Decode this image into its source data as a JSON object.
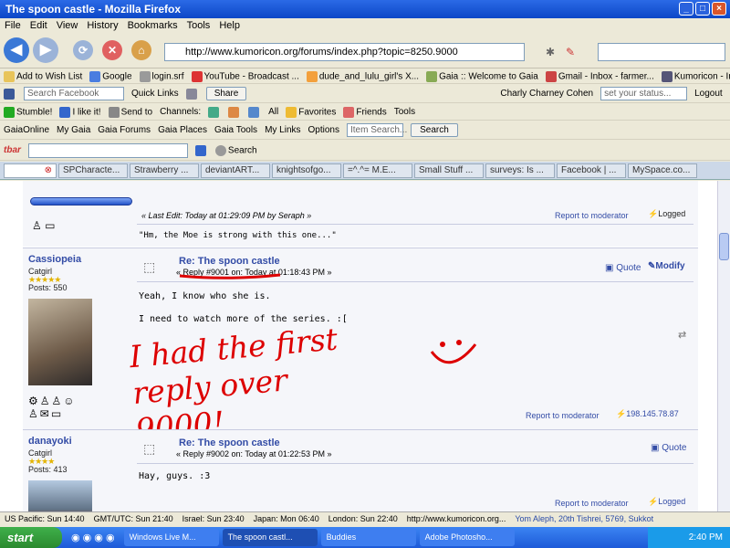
{
  "window": {
    "title": "The spoon castle - Mozilla Firefox"
  },
  "menu": [
    "File",
    "Edit",
    "View",
    "History",
    "Bookmarks",
    "Tools",
    "Help"
  ],
  "nav": {
    "url": "http://www.kumoricon.org/forums/index.php?topic=8250.9000"
  },
  "bookmarks": [
    "Add to Wish List",
    "Google",
    "login.srf",
    "YouTube - Broadcast ...",
    "dude_and_lulu_girl's X...",
    "Gaia :: Welcome to Gaia",
    "Gmail - Inbox - farmer...",
    "Kumoricon - Index"
  ],
  "facebook_bar": {
    "search_placeholder": "Search Facebook",
    "quick_links": "Quick Links",
    "share": "Share",
    "user": "Charly Charney Cohen",
    "status_placeholder": "set your status...",
    "logout": "Logout"
  },
  "stumble_bar": [
    "Stumble!",
    "I like it!",
    "Send to",
    "Channels:",
    "All",
    "Favorites",
    "Friends",
    "Tools"
  ],
  "gaia_bar": {
    "items": [
      "GaiaOnline",
      "My Gaia",
      "Gaia Forums",
      "Gaia Places",
      "Gaia Tools",
      "My Links",
      "Options"
    ],
    "search_placeholder": "Item Search...",
    "search_button": "Search"
  },
  "tbar": {
    "logo": "tbar",
    "search": "Search"
  },
  "tabs": [
    "",
    "SPCharacte...",
    "Strawberry ...",
    "deviantART...",
    "knightsofgo...",
    "=^.^= M.E...",
    "Small Stuff ...",
    "surveys: Is ...",
    "Facebook | ...",
    "MySpace.co..."
  ],
  "post0": {
    "last_edit": "« Last Edit: Today at 01:29:09 PM by Seraph »",
    "report": "Report to moderator",
    "logged": "Logged",
    "signature": "\"Hm, the Moe is strong with this one...\""
  },
  "post1": {
    "user": "Cassiopeia",
    "rank": "Catgirl",
    "posts": "Posts: 550",
    "title": "Re: The spoon castle",
    "reply_info": "« Reply #9001 on: Today at 01:18:43 PM »",
    "quote": "Quote",
    "modify": "Modify",
    "line1": "Yeah, I know who she is.",
    "line2": "I need to watch more of the series. :[",
    "scribble": "I had the first reply over 9000!",
    "report": "Report to moderator",
    "ip": "198.145.78.87"
  },
  "post2": {
    "user": "danayoki",
    "rank": "Catgirl",
    "posts": "Posts: 413",
    "title": "Re: The spoon castle",
    "reply_info": "« Reply #9002 on: Today at 01:22:53 PM »",
    "quote": "Quote",
    "line1": "Hay, guys. :3",
    "report": "Report to moderator",
    "logged": "Logged"
  },
  "status": [
    "US Pacific: Sun 14:40",
    "GMT/UTC: Sun 21:40",
    "Israel: Sun 23:40",
    "Japan: Mon 06:40",
    "London: Sun 22:40",
    "http://www.kumoricon.org...",
    "Yom Aleph, 20th Tishrei, 5769, Sukkot"
  ],
  "taskbar": {
    "start": "start",
    "tasks": [
      "Windows Live M...",
      "The spoon castl...",
      "Buddies",
      "Adobe Photosho..."
    ],
    "clock": "2:40 PM"
  }
}
